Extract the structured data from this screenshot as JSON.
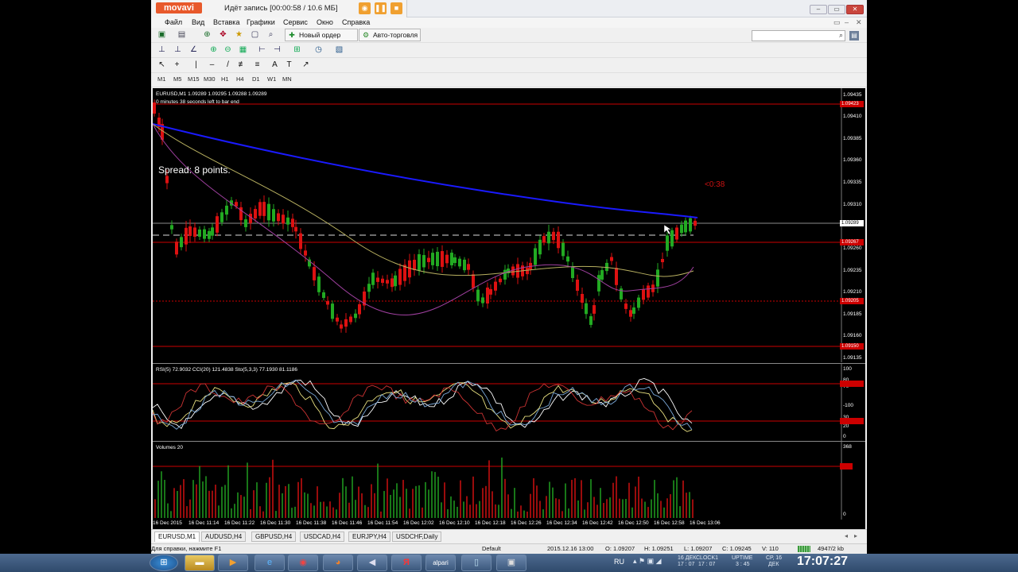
{
  "recorder": {
    "brand": "movavi",
    "status": "Идёт запись [00:00:58 / 10.6 МБ]"
  },
  "menu": [
    "Файл",
    "Вид",
    "Вставка",
    "Графики",
    "Сервис",
    "Окно",
    "Справка"
  ],
  "toolbar": {
    "new_order": "Новый ордер",
    "autotrading": "Авто-торговля"
  },
  "timeframes": [
    "M1",
    "M5",
    "M15",
    "M30",
    "H1",
    "H4",
    "D1",
    "W1",
    "MN"
  ],
  "chart": {
    "header": "EURUSD,M1  1.09289 1.09295 1.09288 1.09289",
    "bar_timer": "0 minutes 38 seconds left to bar end",
    "spread": "Spread: 8 points.",
    "countdown": "<0:38",
    "price_labels": [
      "1.09435",
      "1.09410",
      "1.09385",
      "1.09360",
      "1.09335",
      "1.09310",
      "1.09285",
      "1.09260",
      "1.09235",
      "1.09210",
      "1.09185",
      "1.09160",
      "1.09135"
    ],
    "current_price": "1.09289",
    "level_tags": [
      "1.09423",
      "1.09267",
      "1.09205",
      "1.09150"
    ],
    "osc_header": "RSI(5) 72.9032  CCI(20) 121.4838  Sto(5,3,3) 77.1930 81.1186",
    "osc_labels": [
      "100",
      "80",
      "70",
      "-100",
      "30",
      "20",
      "0"
    ],
    "vol_header": "Volumes 20",
    "vol_labels": [
      "368",
      "0"
    ],
    "time_labels": [
      "16 Dec 2015",
      "16 Dec 11:14",
      "16 Dec 11:22",
      "16 Dec 11:30",
      "16 Dec 11:38",
      "16 Dec 11:46",
      "16 Dec 11:54",
      "16 Dec 12:02",
      "16 Dec 12:10",
      "16 Dec 12:18",
      "16 Dec 12:26",
      "16 Dec 12:34",
      "16 Dec 12:42",
      "16 Dec 12:50",
      "16 Dec 12:58",
      "16 Dec 13:06"
    ]
  },
  "tabs": [
    "EURUSD,M1",
    "AUDUSD,H4",
    "GBPUSD,H4",
    "USDCAD,H4",
    "EURJPY,H4",
    "USDCHF,Daily"
  ],
  "status": {
    "help": "Для справки, нажмите F1",
    "profile": "Default",
    "datetime": "2015.12.16 13:00",
    "open": "O: 1.09207",
    "high": "H: 1.09251",
    "low": "L: 1.09207",
    "close": "C: 1.09245",
    "volume": "V: 110",
    "traffic": "4947/2 kb"
  },
  "taskbar": {
    "lang": "RU",
    "clock": "17:07:27",
    "tray1": "16 ДЕК",
    "tray1b": "17 : 07",
    "tray2": "CLOCK1",
    "tray2b": "17 : 07",
    "tray3": "UPTIME",
    "tray3b": "3 : 45",
    "tray4": "СР, 16",
    "tray4b": "ДЕК",
    "alpari": "alpari"
  },
  "colors": {
    "ma_blue": "#1a1aff",
    "ma_khaki": "#b8b060",
    "ma_purple": "#a040a0",
    "level_red": "#cc0000",
    "candle_up": "#22aa22",
    "candle_down": "#dd1111"
  }
}
